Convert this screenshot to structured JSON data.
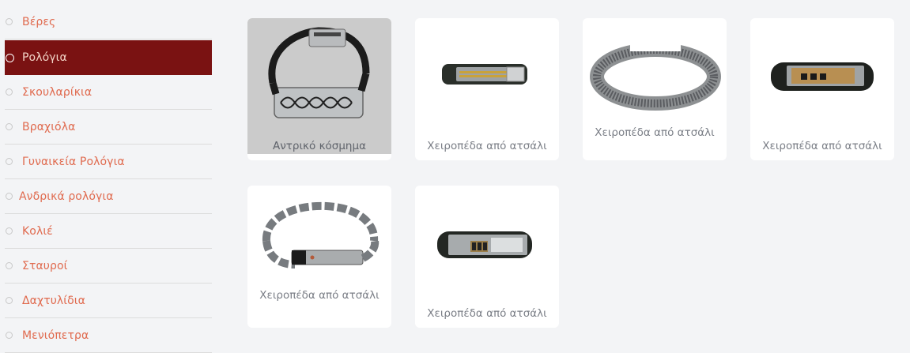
{
  "sidebar": {
    "items": [
      {
        "label": "Βέρες"
      },
      {
        "label": "Ρολόγια",
        "active": true
      },
      {
        "label": "Σκουλαρίκια"
      },
      {
        "label": "Βραχιόλα"
      },
      {
        "label": "Γυναικεία Ρολόγια"
      },
      {
        "label": "Ανδρικά ρολόγια"
      },
      {
        "label": "Κολιέ"
      },
      {
        "label": "Σταυροί"
      },
      {
        "label": "Δαχτυλίδια"
      },
      {
        "label": "Μενιόπετρα"
      }
    ]
  },
  "products": [
    {
      "title": "Αντρικό κόσμημα"
    },
    {
      "title": "Χειροπέδα από ατσάλι"
    },
    {
      "title": "Χειροπέδα από ατσάλι"
    },
    {
      "title": "Χειροπέδα από ατσάλι"
    },
    {
      "title": "Χειροπέδα από ατσάλι"
    },
    {
      "title": "Χειροπέδα από ατσάλι"
    }
  ],
  "colors": {
    "active_bg": "#7a1212",
    "link": "#e06a4e",
    "page_bg": "#f3f4f6"
  }
}
